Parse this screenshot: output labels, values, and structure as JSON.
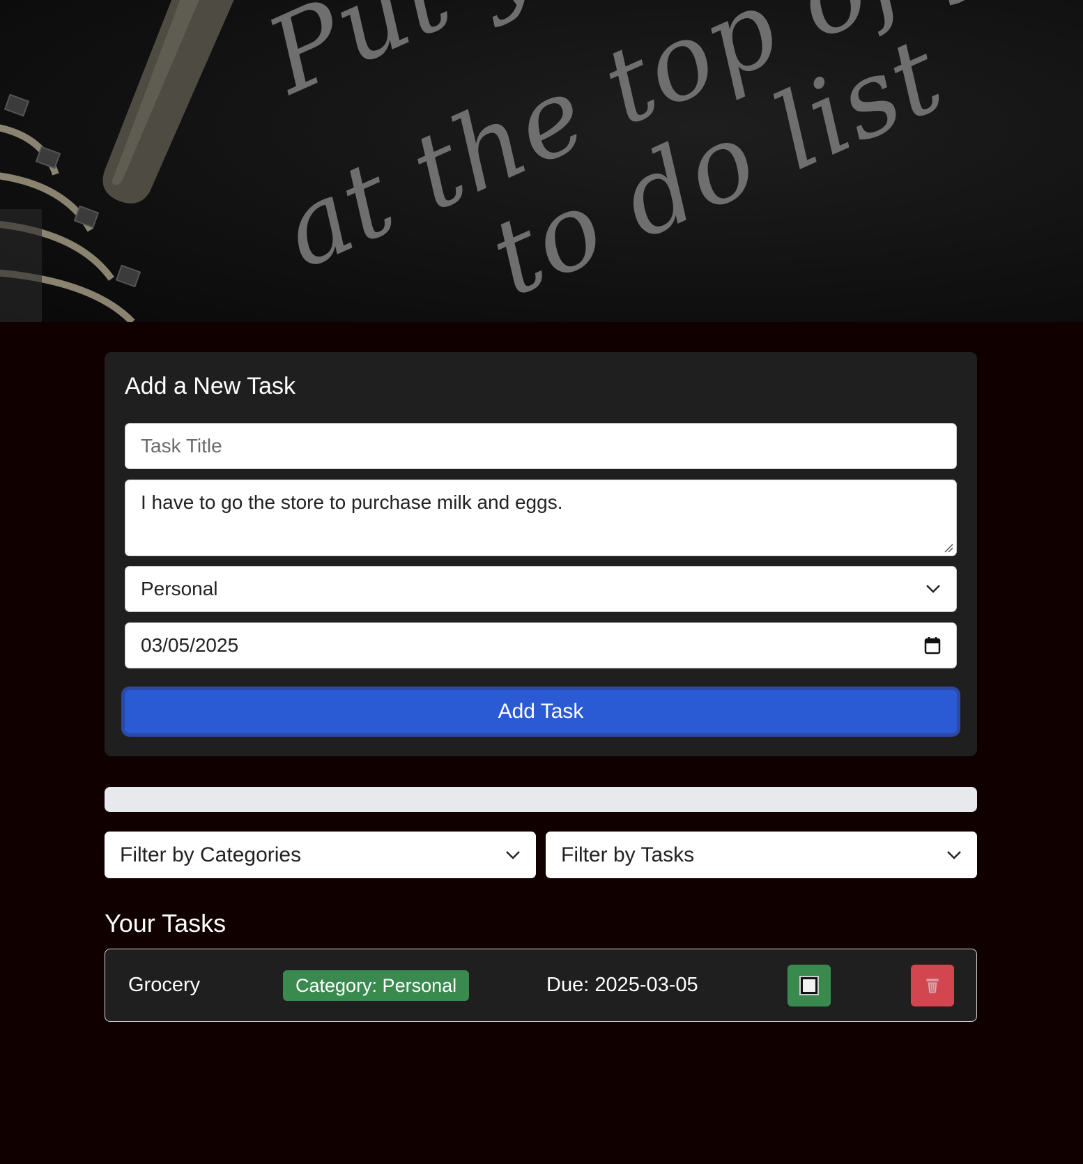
{
  "hero": {
    "line1": "Put your",
    "line2": "at the top of your",
    "line3": "to do list"
  },
  "add_task_form": {
    "heading": "Add a New Task",
    "title_placeholder": "Task Title",
    "description_value": "I have to go the store to purchase milk and eggs.",
    "category_value": "Personal",
    "due_date_value": "03/05/2025",
    "submit_label": "Add Task"
  },
  "progress": {
    "value": 0
  },
  "filters": {
    "categories_label": "Filter by Categories",
    "tasks_label": "Filter by Tasks"
  },
  "tasks_section": {
    "heading": "Your Tasks",
    "tasks": [
      {
        "title": "Grocery",
        "category": "Category: Personal",
        "due": "Due: 2025-03-05"
      }
    ]
  },
  "colors": {
    "page_background": "#100000",
    "card_background": "#1f1f1f",
    "primary_button": "#2a5bd4",
    "complete_button": "#3a8a50",
    "delete_button": "#d4464f"
  },
  "icons": {
    "select_arrow": "chevron-down-icon",
    "date_picker": "calendar-icon",
    "complete": "checkbox-icon",
    "delete": "trash-icon"
  }
}
